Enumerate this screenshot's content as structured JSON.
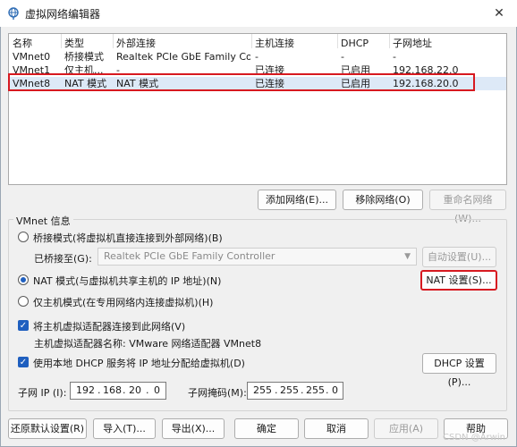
{
  "window": {
    "title": "虚拟网络编辑器",
    "close_glyph": "✕"
  },
  "table": {
    "headers": [
      "名称",
      "类型",
      "外部连接",
      "主机连接",
      "DHCP",
      "子网地址"
    ],
    "rows": [
      [
        "VMnet0",
        "桥接模式",
        "Realtek PCIe GbE Family Cont...",
        "-",
        "-",
        "-"
      ],
      [
        "VMnet1",
        "仅主机...",
        "-",
        "已连接",
        "已启用",
        "192.168.22.0"
      ],
      [
        "VMnet8",
        "NAT 模式",
        "NAT 模式",
        "已连接",
        "已启用",
        "192.168.20.0"
      ]
    ],
    "selected_row": 2
  },
  "net_buttons": {
    "add": "添加网络(E)...",
    "remove": "移除网络(O)",
    "rename": "重命名网络(W)..."
  },
  "info": {
    "group_label": "VMnet 信息",
    "bridge_mode": "桥接模式(将虚拟机直接连接到外部网络)(B)",
    "bridged_to_label": "已桥接至(G):",
    "bridged_to_value": "Realtek PCIe GbE Family Controller",
    "auto_settings": "自动设置(U)...",
    "nat_mode": "NAT 模式(与虚拟机共享主机的 IP 地址)(N)",
    "nat_settings": "NAT 设置(S)...",
    "host_only": "仅主机模式(在专用网络内连接虚拟机)(H)",
    "connect_adapter": "将主机虚拟适配器连接到此网络(V)",
    "adapter_name": "主机虚拟适配器名称: VMware 网络适配器 VMnet8",
    "use_dhcp": "使用本地 DHCP 服务将 IP 地址分配给虚拟机(D)",
    "dhcp_settings": "DHCP 设置(P)...",
    "subnet_ip_label": "子网 IP (I):",
    "subnet_ip": [
      "192",
      "168",
      "20",
      "0"
    ],
    "subnet_mask_label": "子网掩码(M):",
    "subnet_mask": [
      "255",
      "255",
      "255",
      "0"
    ]
  },
  "bottom_buttons": {
    "restore": "还原默认设置(R)",
    "import": "导入(T)...",
    "export": "导出(X)...",
    "ok": "确定",
    "cancel": "取消",
    "apply": "应用(A)",
    "help": "帮助"
  },
  "watermark": "CSDN @Arwin"
}
